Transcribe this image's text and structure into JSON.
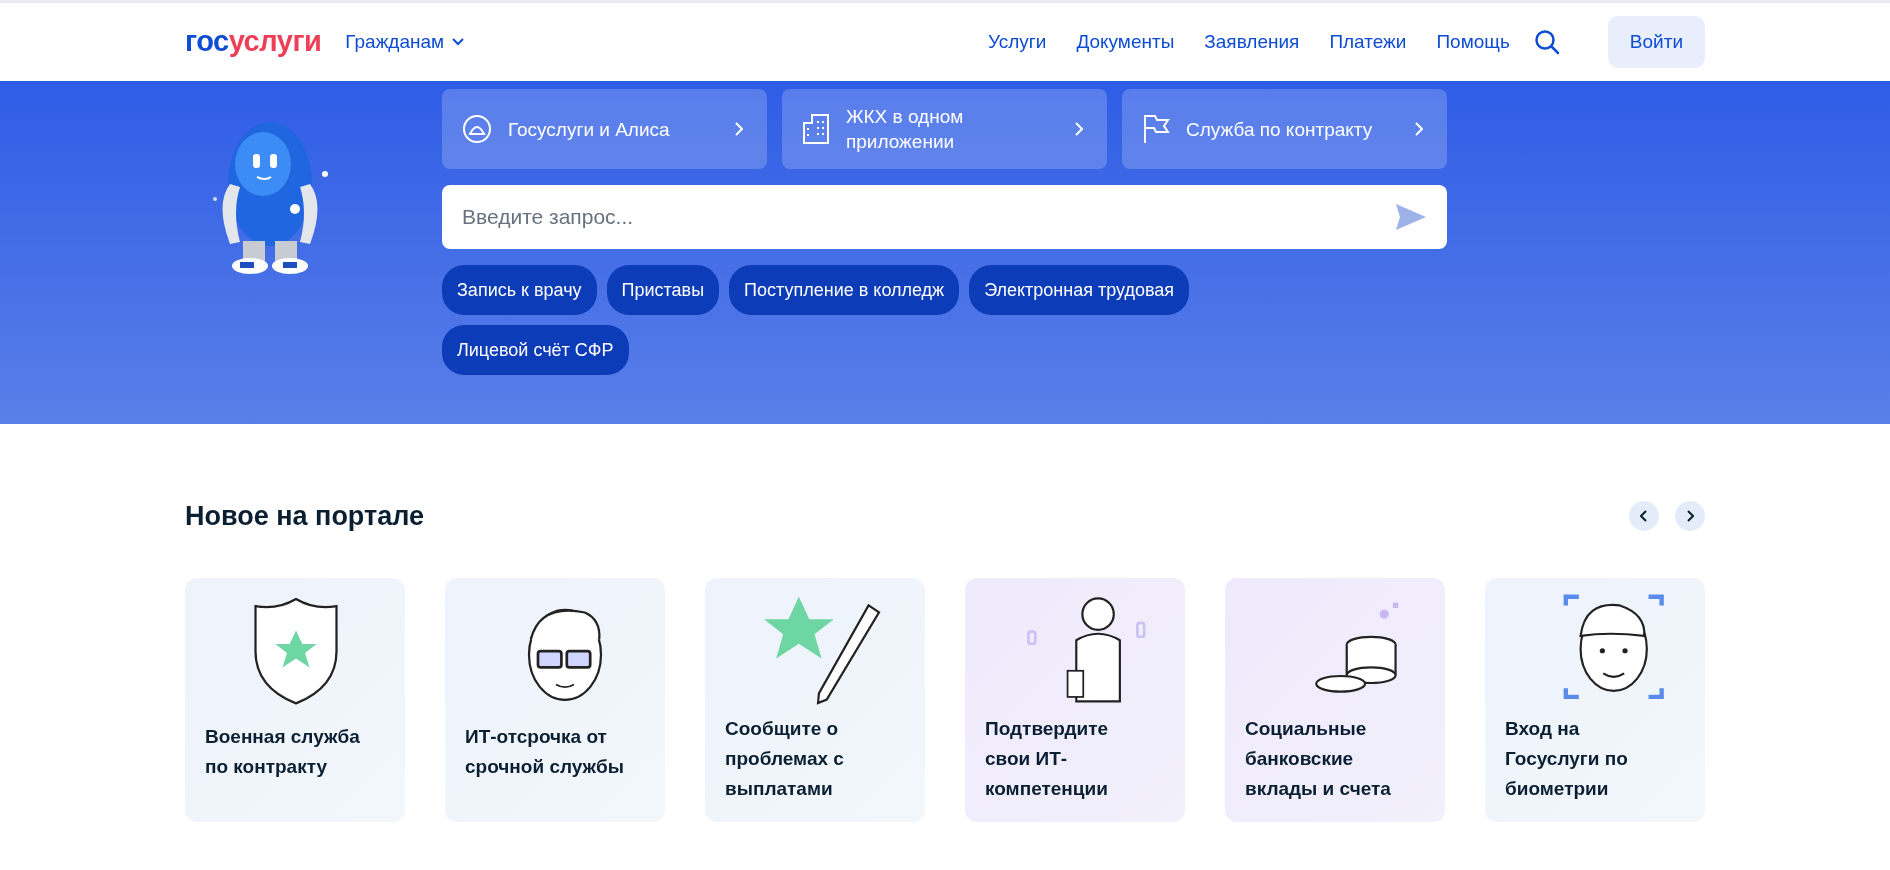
{
  "header": {
    "logo_parts": [
      {
        "text": "гос",
        "color": "#0d4cd3"
      },
      {
        "text": "услуги",
        "color": "#ee3f58"
      }
    ],
    "audience": "Гражданам",
    "nav": [
      "Услуги",
      "Документы",
      "Заявления",
      "Платежи",
      "Помощь"
    ],
    "login": "Войти"
  },
  "hero": {
    "promos": [
      {
        "text": "Госуслуги и Алиса"
      },
      {
        "text": "ЖКХ в одном приложении"
      },
      {
        "text": "Служба по контракту"
      }
    ],
    "search": {
      "placeholder": "Введите запрос..."
    },
    "chips": [
      "Запись к врачу",
      "Приставы",
      "Поступление в колледж",
      "Электронная трудовая",
      "Лицевой счёт СФР"
    ]
  },
  "news": {
    "title": "Новое на портале",
    "cards": [
      {
        "text": "Военная служба по контракту"
      },
      {
        "text": "ИТ-отсрочка от срочной службы"
      },
      {
        "text": "Сообщите о проблемах с выплатами"
      },
      {
        "text": "Подтвердите свои ИТ-компетенции"
      },
      {
        "text": "Социальные банковские вклады и счета"
      },
      {
        "text": "Вход на Госуслуги по биометрии"
      }
    ]
  }
}
